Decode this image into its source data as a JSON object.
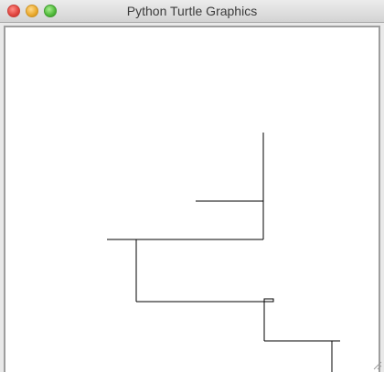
{
  "window": {
    "title": "Python Turtle Graphics"
  },
  "controls": {
    "close_icon": "close-traffic-light",
    "minimize_icon": "minimize-traffic-light",
    "zoom_icon": "zoom-traffic-light",
    "colors": {
      "close": "#e0443e",
      "minimize": "#e9a92c",
      "zoom": "#4fb93a"
    }
  },
  "canvas": {
    "background": "#ffffff",
    "stroke_color": "#000000",
    "drawing": "turtle-line-path"
  }
}
